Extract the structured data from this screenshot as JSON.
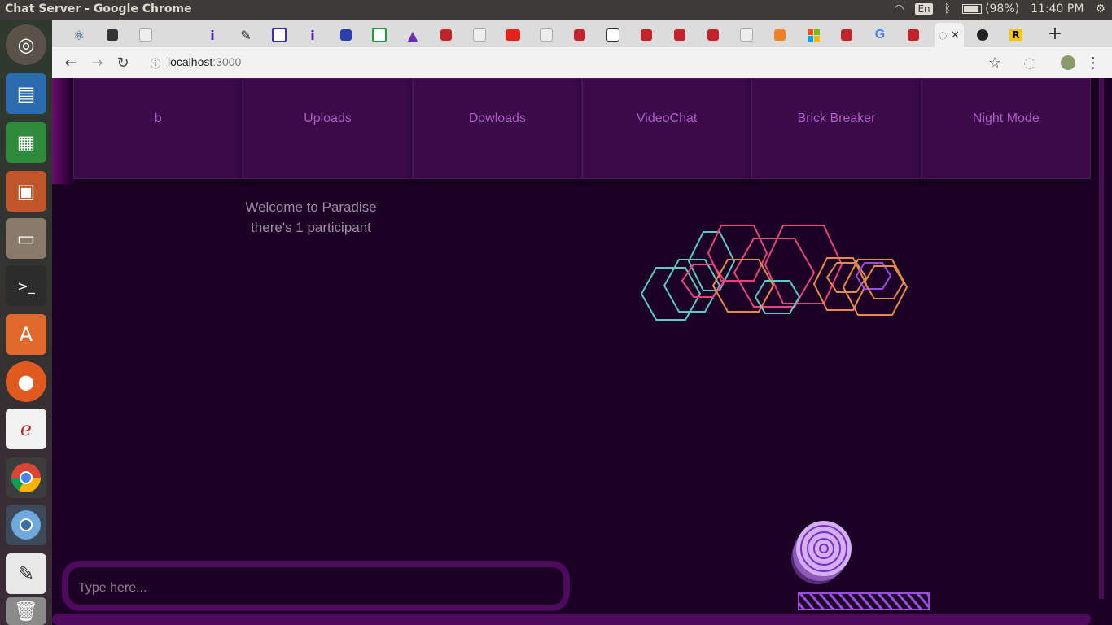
{
  "os": {
    "window_title": "Chat Server - Google Chrome",
    "keyboard_layout": "En",
    "battery": "(98%)",
    "time": "11:40 PM"
  },
  "browser": {
    "url_host": "localhost",
    "url_port": ":3000",
    "new_tab_label": "+",
    "close_tab_label": "×"
  },
  "menu": {
    "items": [
      {
        "label": "b"
      },
      {
        "label": "Uploads"
      },
      {
        "label": "Dowloads"
      },
      {
        "label": "VideoChat"
      },
      {
        "label": "Brick Breaker"
      },
      {
        "label": "Night Mode"
      }
    ]
  },
  "welcome": {
    "line1": "Welcome to Paradise",
    "line2": "there's 1 participant"
  },
  "chat": {
    "placeholder": "Type here..."
  },
  "colors": {
    "background": "#1c0025",
    "menu_text": "#b05bc6",
    "hex_pink": "#e8447a",
    "hex_teal": "#5ec8c3",
    "hex_orange": "#e58a4f",
    "hex_purple": "#9a4de0"
  }
}
